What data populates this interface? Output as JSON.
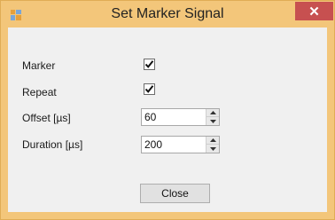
{
  "window": {
    "title": "Set Marker Signal",
    "close_glyph": "✕"
  },
  "form": {
    "marker_label": "Marker",
    "marker_checked": true,
    "repeat_label": "Repeat",
    "repeat_checked": true,
    "offset_label": "Offset [µs]",
    "offset_value": "60",
    "duration_label": "Duration [µs]",
    "duration_value": "200"
  },
  "buttons": {
    "close_label": "Close"
  },
  "colors": {
    "titlebar": "#f3c67a",
    "close_x": "#c75050",
    "client": "#f0f0f0"
  }
}
